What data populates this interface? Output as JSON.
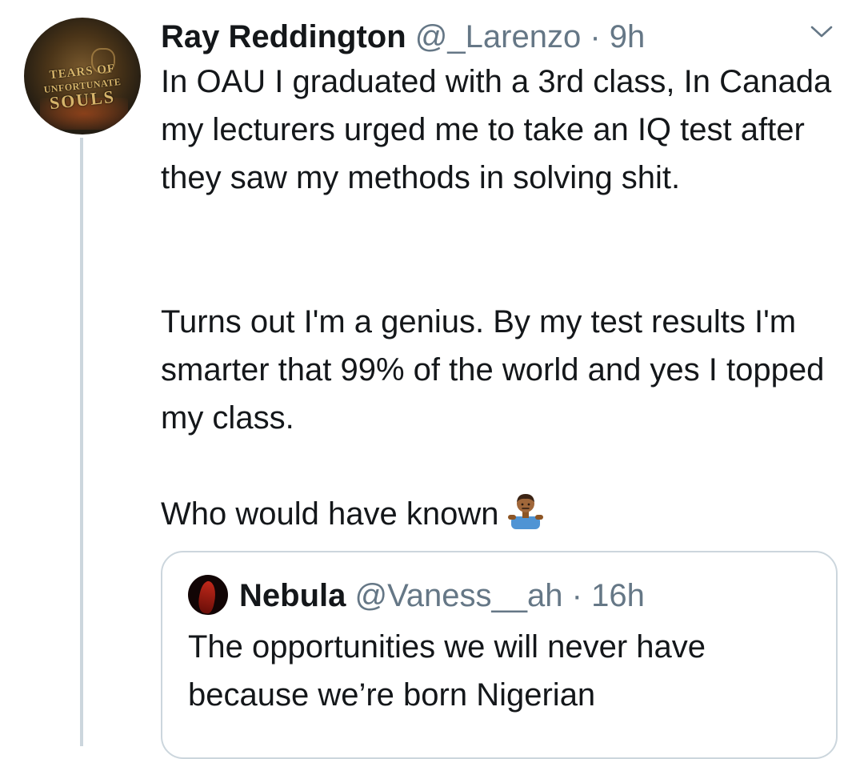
{
  "tweet": {
    "avatar_text": [
      "TEARS OF",
      "UNFORTUNATE",
      "SOULS"
    ],
    "display_name": "Ray Reddington",
    "handle": "@_Larenzo",
    "separator": "·",
    "time": "9h",
    "paragraphs": [
      "In OAU I graduated with a 3rd class, In Canada my lecturers urged me to take an IQ test after they saw my methods in solving shit.",
      "Turns out I'm a genius. By my test results I'm smarter that 99% of the world and yes I topped my class.",
      "Who would have known"
    ],
    "emoji": "man-shrugging-icon"
  },
  "quoted_tweet": {
    "display_name": "Nebula",
    "handle": "@Vaness__ah",
    "separator": "·",
    "time": "16h",
    "text": "The opportunities we will never have because we’re born Nigerian"
  },
  "colors": {
    "text": "#14171a",
    "secondary": "#657786",
    "border": "#ccd6dd"
  }
}
